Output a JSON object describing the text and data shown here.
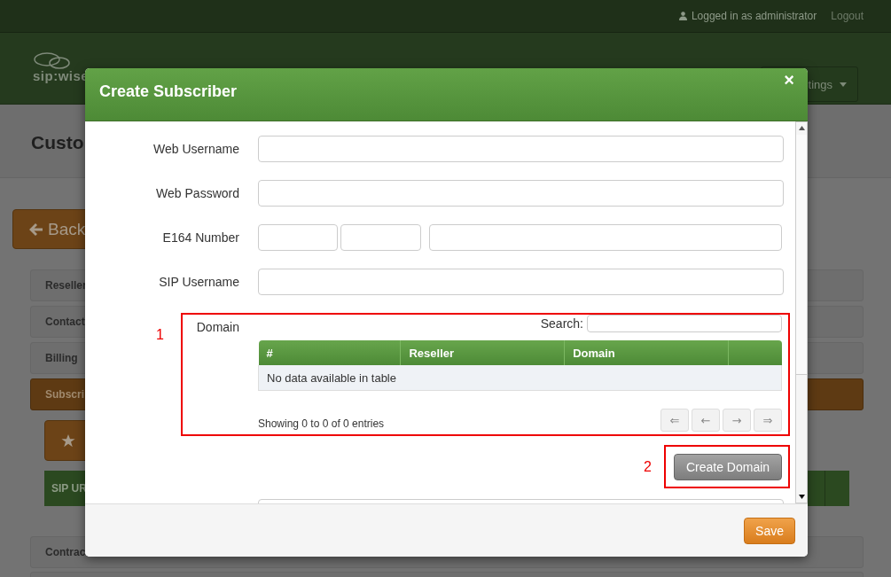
{
  "top_bar": {
    "user": "Logged in as administrator",
    "logout": "Logout"
  },
  "header": {
    "logo": "sip:wise",
    "menu_button": "tings"
  },
  "page": {
    "title": "Custo",
    "back_button": "Back",
    "panels": [
      {
        "label": "Reseller",
        "kind": "plain"
      },
      {
        "label": "Contact",
        "kind": "plain"
      },
      {
        "label": "Billing",
        "kind": "plain"
      },
      {
        "label": "Subscri",
        "kind": "active"
      }
    ],
    "table_header": "SIP UR",
    "panels_below": [
      "Contrac"
    ]
  },
  "dialog": {
    "title": "Create Subscriber",
    "close": "×",
    "fields": [
      {
        "label": "Web Username",
        "kind": "text"
      },
      {
        "label": "Web Password",
        "kind": "text"
      },
      {
        "label": "E164 Number",
        "kind": "e164"
      },
      {
        "label": "SIP Username",
        "kind": "text"
      }
    ],
    "domain": {
      "label": "Domain",
      "annotation": "1",
      "search_label": "Search:",
      "columns": [
        "#",
        "Reseller",
        "Domain"
      ],
      "empty_message": "No data available in table",
      "info": "Showing 0 to 0 of 0 entries",
      "pager": [
        "⇐",
        "←",
        "→",
        "⇒"
      ]
    },
    "create_button": {
      "label": "Create Domain",
      "annotation": "2"
    },
    "save_button": "Save"
  }
}
